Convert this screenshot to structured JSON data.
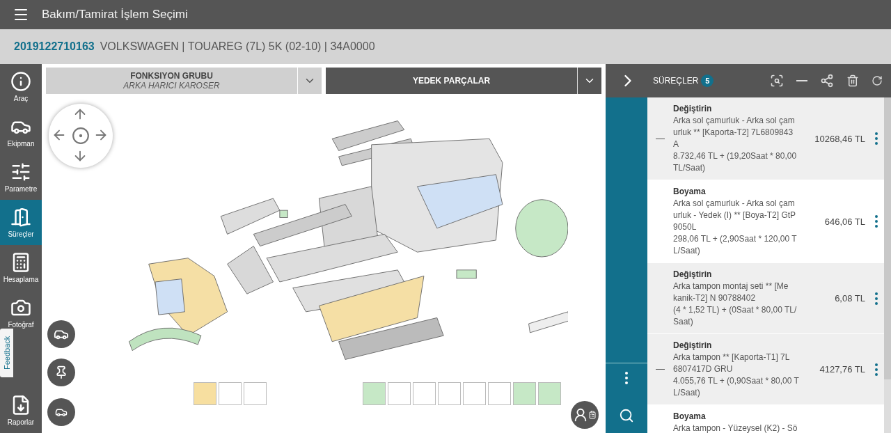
{
  "top_bar": {
    "title": "Bakım/Tamirat İşlem Seçimi"
  },
  "vehicle_bar": {
    "id": "2019122710163",
    "description": "VOLKSWAGEN | TOUAREG (7L) 5K (02-10) | 34A0000"
  },
  "sidebar": {
    "items": [
      {
        "label": "Araç",
        "kind": "info",
        "selected": false
      },
      {
        "label": "Ekipman",
        "kind": "car",
        "selected": false
      },
      {
        "label": "Parametre",
        "kind": "params",
        "selected": false
      },
      {
        "label": "Süreçler",
        "kind": "door",
        "selected": true
      },
      {
        "label": "Hesaplama",
        "kind": "calc",
        "selected": false
      },
      {
        "label": "Fotoğraf",
        "kind": "camera",
        "selected": false
      },
      {
        "label": "Raporlar",
        "kind": "report",
        "selected": false
      }
    ]
  },
  "feedback_tab": {
    "label": "Feedback"
  },
  "function_group": {
    "title": "FONKSIYON GRUBU",
    "value": "ARKA HARICI KAROSER"
  },
  "spare_parts": {
    "title": "YEDEK PARÇALAR"
  },
  "thumbnails_left": [
    {
      "color": "#f7dfa0"
    },
    {
      "color": "#ffffff"
    },
    {
      "color": "#ffffff"
    }
  ],
  "thumbnails_right": [
    {
      "color": "#c6e8c6"
    },
    {
      "color": "#ffffff"
    },
    {
      "color": "#ffffff"
    },
    {
      "color": "#ffffff"
    },
    {
      "color": "#ffffff"
    },
    {
      "color": "#ffffff"
    },
    {
      "color": "#c6e8c6"
    },
    {
      "color": "#c6e8c6"
    }
  ],
  "processes": {
    "title": "SÜREÇLER",
    "count": "5",
    "items": [
      {
        "type": "Değiştirin",
        "selected": true,
        "marked": true,
        "description": [
          "Arka sol çamurluk - Arka sol çam",
          "urluk ** [Kaporta-T2] 7L6809843",
          "A",
          "8.732,46 TL + (19,20Saat * 80,00",
          "TL/Saat)"
        ],
        "price": "10268,46 TL"
      },
      {
        "type": "Boyama",
        "selected": false,
        "marked": false,
        "description": [
          "Arka sol çamurluk - Arka sol çam",
          "urluk - Yedek (I) ** [Boya-T2] GtP",
          "9050L",
          "298,06 TL + (2,90Saat * 120,00 T",
          "L/Saat)"
        ],
        "price": "646,06 TL"
      },
      {
        "type": "Değiştirin",
        "selected": true,
        "marked": false,
        "description": [
          "Arka tampon montaj seti ** [Me",
          "kanik-T2] N 90788402",
          "(4 * 1,52 TL) + (0Saat * 80,00 TL/",
          "Saat)"
        ],
        "price": "6,08 TL"
      },
      {
        "type": "Değiştirin",
        "selected": true,
        "marked": true,
        "description": [
          "Arka tampon ** [Kaporta-T1] 7L",
          "6807417D GRU",
          "4.055,76 TL + (0,90Saat * 80,00 T",
          "L/Saat)"
        ],
        "price": "4127,76 TL"
      },
      {
        "type": "Boyama",
        "selected": false,
        "marked": false,
        "description": [
          "Arka tampon - Yüzeysel (K2) - Sö"
        ]
      }
    ]
  }
}
